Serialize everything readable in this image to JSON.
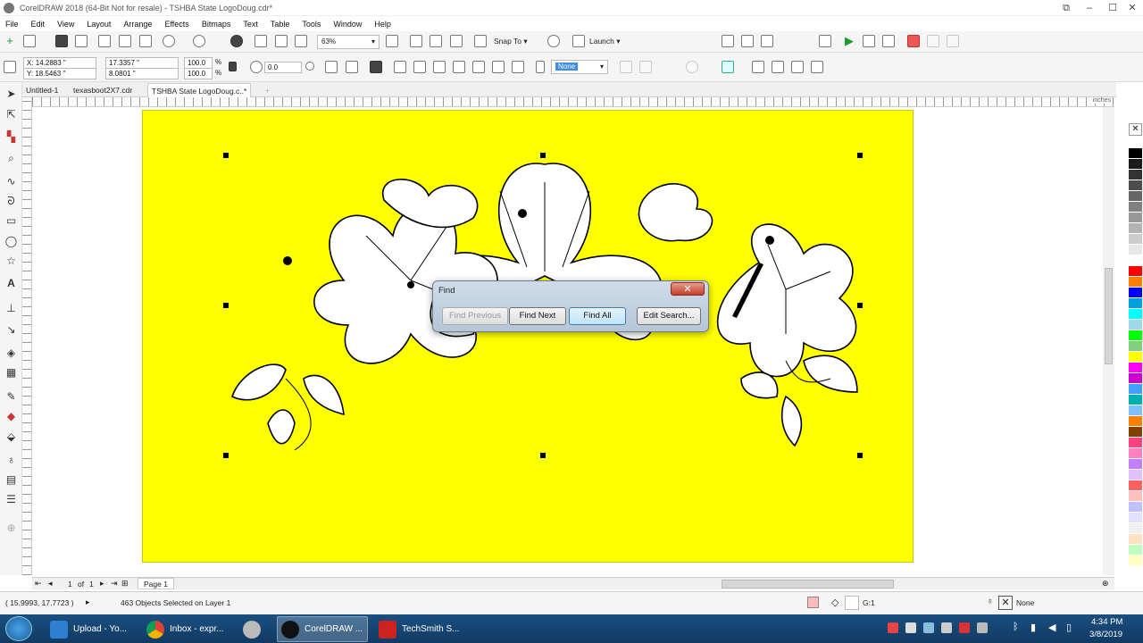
{
  "window": {
    "title": "CorelDRAW 2018 (64-Bit Not for resale) - TSHBA State LogoDoug.cdr*"
  },
  "menu": [
    "File",
    "Edit",
    "View",
    "Layout",
    "Arrange",
    "Effects",
    "Bitmaps",
    "Text",
    "Table",
    "Tools",
    "Window",
    "Help"
  ],
  "standard_bar": {
    "zoom": "63%",
    "snap_to": "Snap To",
    "launch": "Launch"
  },
  "property_bar": {
    "x": "X: 14.2883 \"",
    "y": "Y: 18.5463 \"",
    "w": "17.3357 \"",
    "h": "8.0801 \"",
    "scale_w": "100.0",
    "scale_h": "100.0",
    "scale_unit": "%",
    "angle": "0.0",
    "outline": "None"
  },
  "tabs": [
    "Untitled-1",
    "texasboot2X7.cdr",
    "TSHBA State LogoDoug.c..*"
  ],
  "ruler": {
    "units": "inches"
  },
  "doc_nav": {
    "page_current": "1",
    "of": "of",
    "page_total": "1",
    "page_tab": "Page 1"
  },
  "find_dialog": {
    "title": "Find",
    "close": "✕",
    "buttons": [
      "Find Previous",
      "Find Next",
      "Find All",
      "Edit Search..."
    ]
  },
  "status": {
    "coords": "( 15.9993, 17.7723 )",
    "selection": "463 Objects Selected on Layer 1",
    "fill": "G:1",
    "outline": "None"
  },
  "palette": [
    "#ffffff",
    "#000000",
    "#1a1a1a",
    "#333333",
    "#4d4d4d",
    "#666666",
    "#808080",
    "#999999",
    "#b3b3b3",
    "#cccccc",
    "#e6e6e6",
    "#ffffff",
    "#ff0000",
    "#ff7f00",
    "#0000ff",
    "#00a0e0",
    "#00ffff",
    "#9fd8e8",
    "#00ff00",
    "#7fd07f",
    "#ffff00",
    "#ff00ff",
    "#cc00cc",
    "#3fa0ff",
    "#00b0b0",
    "#80c0ff",
    "#ff8000",
    "#804000",
    "#ff4080",
    "#ff80c0",
    "#c080ff",
    "#e0c0ff",
    "#ff6060",
    "#ffc0c0",
    "#c0c0ff",
    "#e0e0ff",
    "#f0f0f0",
    "#ffe0c0",
    "#c0ffc0",
    "#ffffc0"
  ],
  "taskbar": {
    "items": [
      "Upload - Yo...",
      "Inbox - expr...",
      "",
      "CorelDRAW ...",
      "TechSmith S..."
    ],
    "time": "4:34 PM",
    "date": "3/8/2019"
  },
  "colors": {
    "page": "#ffff00",
    "taskbar": "#1b4f80",
    "selection_blue": "#3d8ee6"
  }
}
